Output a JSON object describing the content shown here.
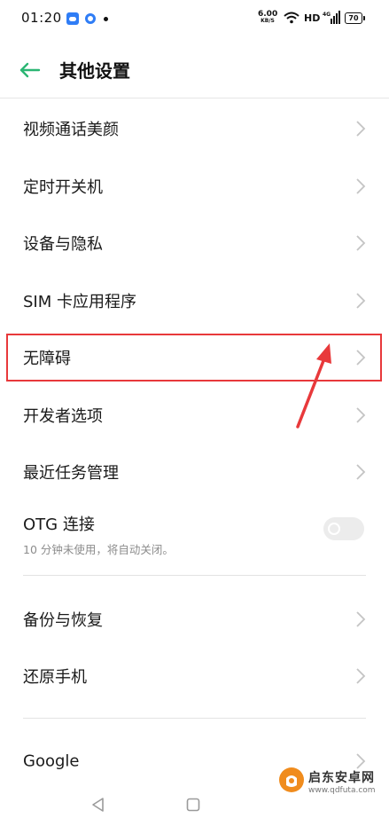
{
  "status_bar": {
    "time": "01:20",
    "network_speed": "6.00",
    "network_speed_unit": "KB/S",
    "hd_label": "HD",
    "signal_label": "4G",
    "battery_level": "70",
    "notification_icons": [
      "cloud-app-icon",
      "ring-app-icon",
      "more-dot-icon"
    ]
  },
  "header": {
    "back_icon": "back-arrow-icon",
    "title": "其他设置",
    "accent_color": "#2bb673"
  },
  "settings": {
    "items": [
      {
        "label": "视频通话美颜"
      },
      {
        "label": "定时开关机"
      },
      {
        "label": "设备与隐私"
      },
      {
        "label": "SIM 卡应用程序"
      },
      {
        "label": "无障碍"
      },
      {
        "label": "开发者选项"
      },
      {
        "label": "最近任务管理"
      }
    ],
    "otg": {
      "label": "OTG 连接",
      "description": "10 分钟未使用，将自动关闭。",
      "enabled": false
    },
    "group2": [
      {
        "label": "备份与恢复"
      },
      {
        "label": "还原手机"
      }
    ],
    "group3": [
      {
        "label": "Google"
      }
    ]
  },
  "annotation": {
    "highlighted_item": "无障碍",
    "color": "#e8393b"
  },
  "watermark": {
    "name": "启东安卓网",
    "url": "www.qdfuta.com"
  }
}
